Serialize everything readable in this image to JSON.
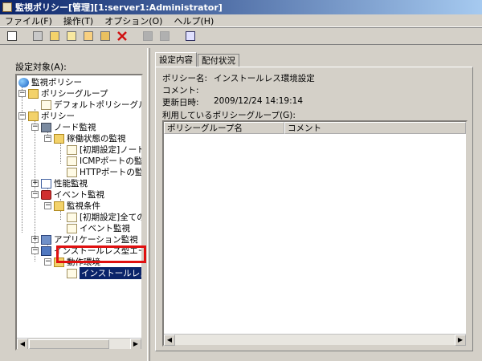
{
  "window": {
    "title": "監視ポリシー[管理][1:server1:Administrator]"
  },
  "menu": [
    {
      "label": "ファイル(F)"
    },
    {
      "label": "操作(T)"
    },
    {
      "label": "オプション(O)"
    },
    {
      "label": "ヘルプ(H)"
    }
  ],
  "left_pane": {
    "label": "設定対象(A):"
  },
  "tree": {
    "root": "監視ポリシー",
    "policy_group": "ポリシーグループ",
    "default_group": "デフォルトポリシーグルー",
    "policy": "ポリシー",
    "node_monitor": "ノード監視",
    "operation_monitor": "稼働状態の監視",
    "init_node": "[初期設定]ノード稼",
    "icmp_port": "ICMPポートの監視",
    "http_port": "HTTPポートの監視",
    "perf_monitor": "性能監視",
    "event_monitor": "イベント監視",
    "monitor_condition": "監視条件",
    "init_all": "[初期設定]全てのイ",
    "event_watch": "イベント監視",
    "app_monitor": "アプリケーション監視",
    "installless_agent": "インストールレス型エージ",
    "operating_env": "動作環境",
    "installless": "インストールレス環"
  },
  "tabs": [
    {
      "label": "設定内容",
      "active": true
    },
    {
      "label": "配付状況",
      "active": false
    }
  ],
  "detail": {
    "policy_name_key": "ポリシー名:",
    "policy_name_value": "インストールレス環境設定",
    "comment_key": "コメント:",
    "comment_value": "",
    "updated_key": "更新日時:",
    "updated_value": "2009/12/24 14:19:14",
    "used_groups_label": "利用しているポリシーグループ(G):",
    "columns": [
      "ポリシーグループ名",
      "コメント"
    ],
    "rows": []
  },
  "icons": {
    "toolbar": [
      "properties-icon",
      "new-icon",
      "open-icon",
      "edit-icon",
      "copy-icon",
      "paste-icon",
      "delete-icon",
      "disabled-icon-1",
      "disabled-icon-2",
      "refresh-icon"
    ]
  },
  "colors": {
    "selection": "#0a246a",
    "highlight_box": "#e01010",
    "titlebar": "#0a246a"
  }
}
